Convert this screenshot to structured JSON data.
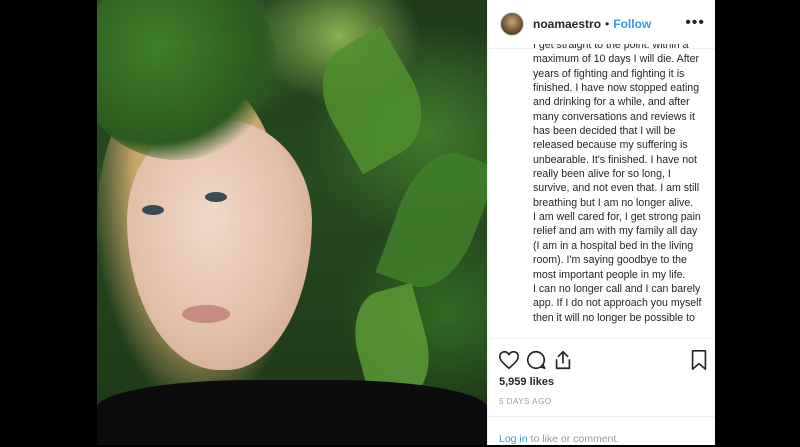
{
  "post": {
    "username": "noamaestro",
    "separator": "•",
    "follow_label": "Follow",
    "more_label": "•••",
    "caption": {
      "p1": "I get straight to the point: within a maximum of 10 days I will die. After years of fighting and fighting it is finished. I have now stopped eating and drinking for a while, and after many conversations and reviews it has been decided that I will be released because my suffering is unbearable. It's finished. I have not really been alive for so long, I survive, and not even that. I am still breathing but I am no longer alive.",
      "p2": "I am well cared for, I get strong pain relief and am with my family all day (I am in a hospital bed in the living room). I'm saying goodbye to the most important people in my life.",
      "p3": "I can no longer call and I can barely app. If I do not approach you myself then it will no longer be possible to"
    },
    "likes": "5,959 likes",
    "date": "5 DAYS AGO",
    "login": {
      "link": "Log in",
      "text": " to like or comment."
    }
  },
  "icons": {
    "like": "heart-icon",
    "comment": "comment-icon",
    "share": "share-icon",
    "save": "bookmark-icon"
  }
}
